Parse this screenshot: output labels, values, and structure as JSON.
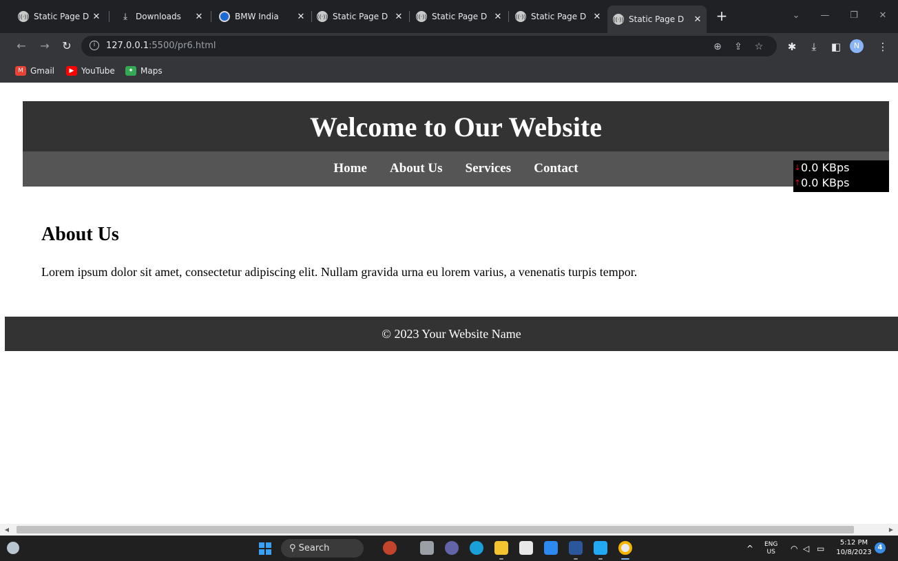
{
  "browser": {
    "tabs": [
      {
        "title": "Static Page D",
        "icon": "broadcast-icon"
      },
      {
        "title": "Downloads",
        "icon": "download-icon"
      },
      {
        "title": "BMW India",
        "icon": "bmw-logo-icon"
      },
      {
        "title": "Static Page D",
        "icon": "broadcast-icon"
      },
      {
        "title": "Static Page D",
        "icon": "broadcast-icon"
      },
      {
        "title": "Static Page D",
        "icon": "broadcast-icon"
      },
      {
        "title": "Static Page D",
        "icon": "broadcast-icon",
        "active": true
      }
    ],
    "address": {
      "host": "127.0.0.1",
      "path": ":5500/pr6.html"
    },
    "bookmarks": [
      {
        "label": "Gmail",
        "icon": "gmail-icon"
      },
      {
        "label": "YouTube",
        "icon": "youtube-icon"
      },
      {
        "label": "Maps",
        "icon": "maps-icon"
      }
    ],
    "profile_initial": "N"
  },
  "site": {
    "title": "Welcome to Our Website",
    "nav": [
      "Home",
      "About Us",
      "Services",
      "Contact"
    ],
    "about_heading": "About Us",
    "about_text": "Lorem ipsum dolor sit amet, consectetur adipiscing elit. Nullam gravida urna eu lorem varius, a venenatis turpis tempor.",
    "footer": "© 2023 Your Website Name"
  },
  "speed_meter": {
    "download": "0.0 KBps",
    "upload": "0.0 KBps"
  },
  "taskbar": {
    "search_label": "Search",
    "language": "ENG",
    "region": "US",
    "time": "5:12 PM",
    "date": "10/8/2023",
    "notification_count": "4"
  },
  "colors": {
    "header_bg": "#333333",
    "nav_bg": "#555555",
    "footer_bg": "#333333"
  }
}
